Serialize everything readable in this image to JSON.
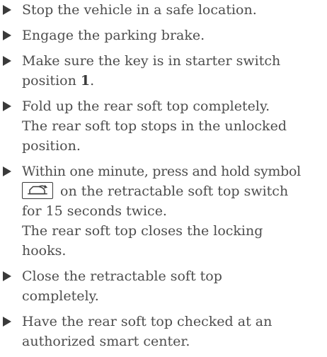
{
  "steps": [
    {
      "lines": [
        "Stop the vehicle in a safe location."
      ]
    },
    {
      "lines": [
        "Engage the parking brake."
      ]
    },
    {
      "text_before": "Make sure the key is in starter switch",
      "text_wrap": "position ",
      "bold": "1",
      "text_after": "."
    },
    {
      "lines": [
        "Fold up the rear soft top completely."
      ],
      "result": [
        "The rear soft top stops in the unlocked",
        "position."
      ]
    },
    {
      "line1": "Within one minute, press and hold symbol",
      "line2_after_icon": " on the retractable soft top switch",
      "line3": "for 15 seconds twice.",
      "result": [
        "The rear soft top closes the locking",
        "hooks."
      ],
      "icon": "convertible-top-symbol-icon"
    },
    {
      "lines": [
        "Close the retractable soft top",
        "completely."
      ]
    },
    {
      "lines": [
        "Have the rear soft top checked at an",
        "authorized smart center."
      ]
    }
  ]
}
